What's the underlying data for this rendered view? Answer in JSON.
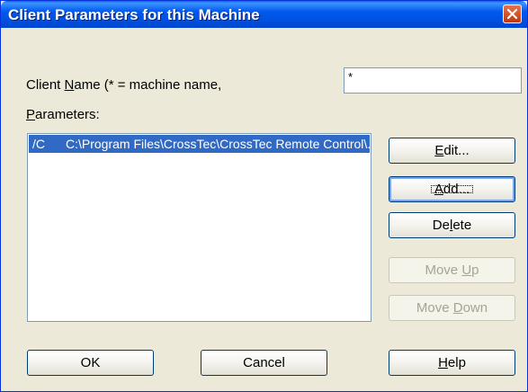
{
  "window": {
    "title": "Client Parameters for this Machine"
  },
  "client_name": {
    "label_pre": "Client ",
    "label_accel": "N",
    "label_post": "ame (* = machine name,",
    "value": "*"
  },
  "parameters": {
    "label_accel": "P",
    "label_post": "arameters:",
    "items": [
      {
        "flag": "/C",
        "path": "C:\\Program Files\\CrossTec\\CrossTec Remote Control\\..."
      }
    ]
  },
  "buttons": {
    "edit": {
      "accel": "E",
      "post": "dit..."
    },
    "add": {
      "accel": "A",
      "post": "dd..."
    },
    "delete": {
      "pre": "De",
      "accel": "l",
      "post": "ete"
    },
    "move_up": {
      "pre": "Move ",
      "accel": "U",
      "post": "p"
    },
    "move_down": {
      "pre": "Move ",
      "accel": "D",
      "post": "own"
    },
    "ok": "OK",
    "cancel": "Cancel",
    "help": {
      "accel": "H",
      "post": "elp"
    }
  },
  "colors": {
    "title_bar": "#0058ee",
    "selection": "#316ac5",
    "dialog_bg": "#ece9d8"
  }
}
